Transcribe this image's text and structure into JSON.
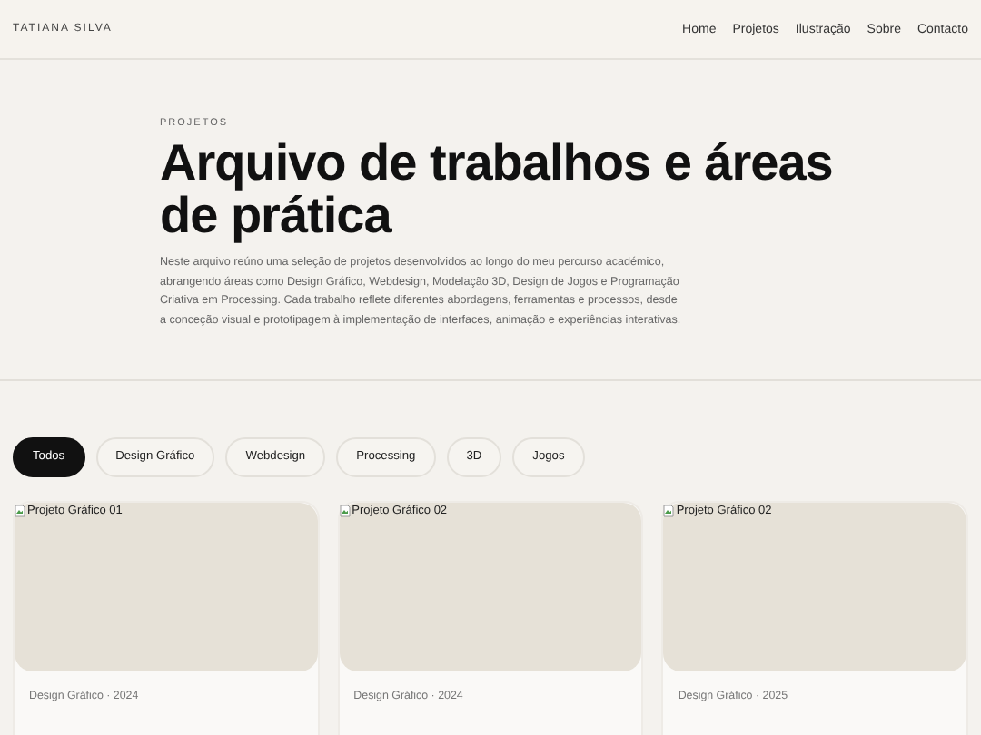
{
  "header": {
    "brand": "TATIANA SILVA",
    "nav": [
      "Home",
      "Projetos",
      "Ilustração",
      "Sobre",
      "Contacto"
    ]
  },
  "hero": {
    "eyebrow": "PROJETOS",
    "title": "Arquivo de trabalhos e áreas de prática",
    "description": "Neste arquivo reúno uma seleção de projetos desenvolvidos ao longo do meu percurso académico, abrangendo áreas como Design Gráfico, Webdesign, Modelação 3D, Design de Jogos e Programação Criativa em Processing. Cada trabalho reflete diferentes abordagens, ferramentas e processos, desde a conceção visual e prototipagem à implementação de interfaces, animação e experiências interativas."
  },
  "filters": [
    {
      "label": "Todos",
      "selected": true
    },
    {
      "label": "Design Gráfico",
      "selected": false
    },
    {
      "label": "Webdesign",
      "selected": false
    },
    {
      "label": "Processing",
      "selected": false
    },
    {
      "label": "3D",
      "selected": false
    },
    {
      "label": "Jogos",
      "selected": false
    }
  ],
  "projects": [
    {
      "image_alt": "Projeto Gráfico 01",
      "meta": "Design Gráfico · 2024"
    },
    {
      "image_alt": "Projeto Gráfico 02",
      "meta": "Design Gráfico · 2024"
    },
    {
      "image_alt": "Projeto Gráfico 02",
      "meta": "Design Gráfico · 2025"
    }
  ]
}
